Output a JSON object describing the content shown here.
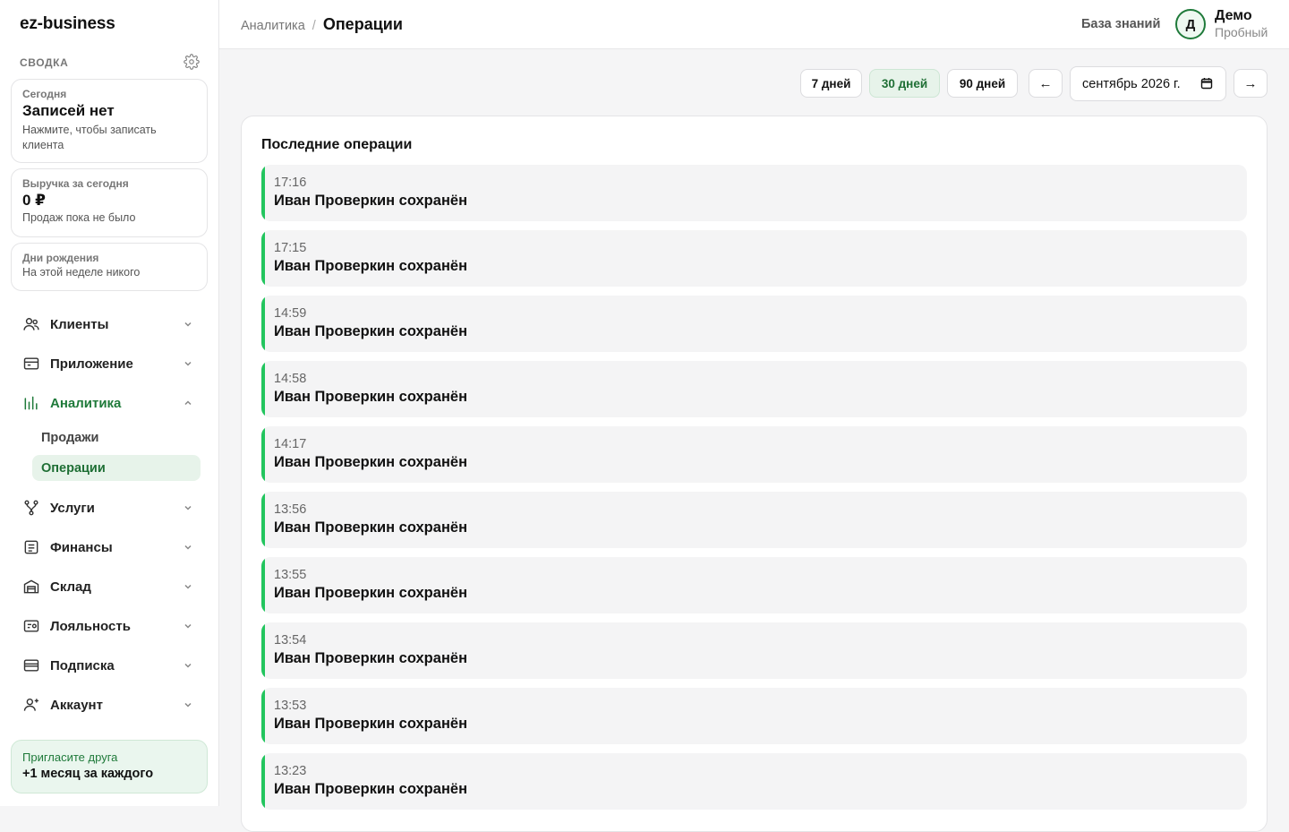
{
  "brand": "ez-business",
  "summary": {
    "title": "СВОДКА",
    "today": {
      "label": "Сегодня",
      "value": "Записей нет",
      "hint": "Нажмите, чтобы записать клиента"
    },
    "revenue": {
      "label": "Выручка за сегодня",
      "value": "0 ₽",
      "hint": "Продаж пока не было"
    },
    "birthdays": {
      "label": "Дни рождения",
      "hint": "На этой неделе никого"
    }
  },
  "nav": {
    "clients": "Клиенты",
    "app": "Приложение",
    "analytics": "Аналитика",
    "sales": "Продажи",
    "operations": "Операции",
    "services": "Услуги",
    "finance": "Финансы",
    "warehouse": "Склад",
    "loyalty": "Лояльность",
    "subscription": "Подписка",
    "account": "Аккаунт"
  },
  "invite": {
    "title": "Пригласите друга",
    "reward": "+1 месяц за каждого"
  },
  "header": {
    "breadcrumb_parent": "Аналитика",
    "breadcrumb_sep": "/",
    "breadcrumb_current": "Операции",
    "knowledge_base": "База знаний",
    "avatar_letter": "Д",
    "user_name": "Демо",
    "user_plan": "Пробный"
  },
  "filters": {
    "d7": "7 дней",
    "d30": "30 дней",
    "d90": "90 дней",
    "active": "30 дней",
    "prev": "←",
    "next": "→",
    "month": "сентябрь 2026 г."
  },
  "operations": {
    "title": "Последние операции",
    "items": [
      {
        "time": "17:16",
        "text": "Иван Проверкин сохранён"
      },
      {
        "time": "17:15",
        "text": "Иван Проверкин сохранён"
      },
      {
        "time": "14:59",
        "text": "Иван Проверкин сохранён"
      },
      {
        "time": "14:58",
        "text": "Иван Проверкин сохранён"
      },
      {
        "time": "14:17",
        "text": "Иван Проверкин сохранён"
      },
      {
        "time": "13:56",
        "text": "Иван Проверкин сохранён"
      },
      {
        "time": "13:55",
        "text": "Иван Проверкин сохранён"
      },
      {
        "time": "13:54",
        "text": "Иван Проверкин сохранён"
      },
      {
        "time": "13:53",
        "text": "Иван Проверкин сохранён"
      },
      {
        "time": "13:23",
        "text": "Иван Проверкин сохранён"
      }
    ]
  },
  "colors": {
    "accent": "#1f7a3a",
    "accent_bg": "#e7f3ea",
    "marker": "#22c55e"
  }
}
